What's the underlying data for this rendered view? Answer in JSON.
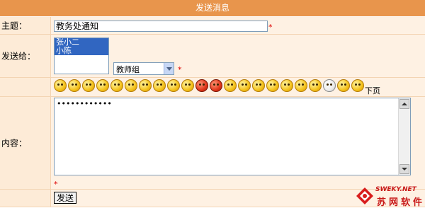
{
  "header": {
    "title": "发送消息"
  },
  "subject": {
    "label": "主题：",
    "value": "教务处通知",
    "required_mark": "*"
  },
  "recipients": {
    "label": "发送给：",
    "list_items": [
      "张小二",
      "小陈"
    ],
    "group_select": "教师组",
    "required_mark": "*"
  },
  "emoticons": {
    "icons": [
      "smile-icon",
      "grin-icon",
      "love-icon",
      "blink-icon",
      "cool-icon",
      "shy-icon",
      "kiss-icon",
      "crazy-icon",
      "sweat-icon",
      "cry-icon",
      "angry-icon",
      "rage-icon",
      "tongue-icon",
      "laugh-icon",
      "wink-icon",
      "sad-icon",
      "evil-icon",
      "sleep-icon",
      "shock-icon",
      "teeth-icon",
      "think-icon",
      "happy-icon"
    ],
    "next_page": "下页"
  },
  "content": {
    "label": "内容：",
    "value": "••••••••••••",
    "required_mark": "*"
  },
  "send_button": "发送",
  "watermark": {
    "site": "SWEKY.NET",
    "name": "苏网软件"
  }
}
